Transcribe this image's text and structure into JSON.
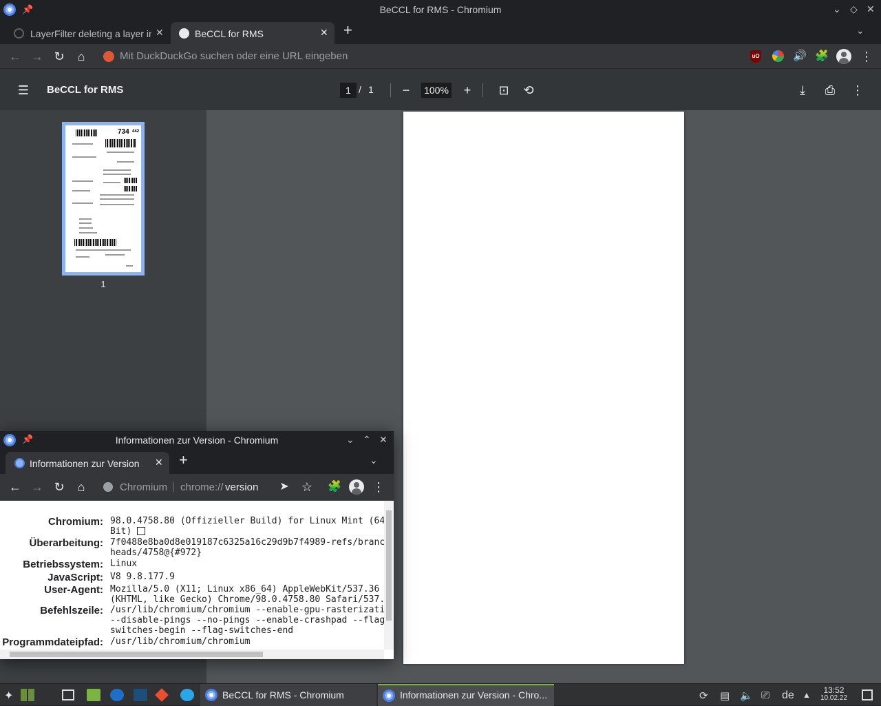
{
  "window": {
    "title": "BeCCL for RMS - Chromium"
  },
  "tabs": [
    {
      "label": "LayerFilter deleting a layer in"
    },
    {
      "label": "BeCCL for RMS"
    }
  ],
  "omnibox": {
    "placeholder": "Mit DuckDuckGo suchen oder eine URL eingeben"
  },
  "pdf": {
    "title": "BeCCL for RMS",
    "page_current": "1",
    "page_sep": "/",
    "page_total": "1",
    "zoom": "100%",
    "thumb_label": "1",
    "thumb_text_1": "734",
    "thumb_text_2": "442"
  },
  "version_window": {
    "title": "Informationen zur Version - Chromium",
    "tab_label": "Informationen zur Version",
    "omnibox_site": "Chromium",
    "omnibox_sep": "|",
    "omnibox_scheme": "chrome://",
    "omnibox_path": "version",
    "rows": [
      {
        "label": "Chromium:",
        "value": "98.0.4758.80 (Offizieller Build) for Linux Mint (64\nBit)"
      },
      {
        "label": "Überarbeitung:",
        "value": "7f0488e8ba0d8e019187c6325a16c29d9b7f4989-refs/branc\nheads/4758@{#972}"
      },
      {
        "label": "Betriebssystem:",
        "value": "Linux"
      },
      {
        "label": "JavaScript:",
        "value": "V8 9.8.177.9"
      },
      {
        "label": "User-Agent:",
        "value": "Mozilla/5.0 (X11; Linux x86_64) AppleWebKit/537.36\n(KHTML, like Gecko) Chrome/98.0.4758.80 Safari/537."
      },
      {
        "label": "Befehlszeile:",
        "value": "/usr/lib/chromium/chromium --enable-gpu-rasterizati\n--disable-pings --no-pings --enable-crashpad --flag\nswitches-begin --flag-switches-end"
      },
      {
        "label": "Programmdateipfad:",
        "value": "/usr/lib/chromium/chromium"
      }
    ]
  },
  "taskbar": {
    "tasks": [
      {
        "label": "BeCCL for RMS - Chromium"
      },
      {
        "label": "Informationen zur Version - Chro..."
      }
    ],
    "keyboard_layout": "de",
    "time": "13:52",
    "date": "10.02.22"
  }
}
